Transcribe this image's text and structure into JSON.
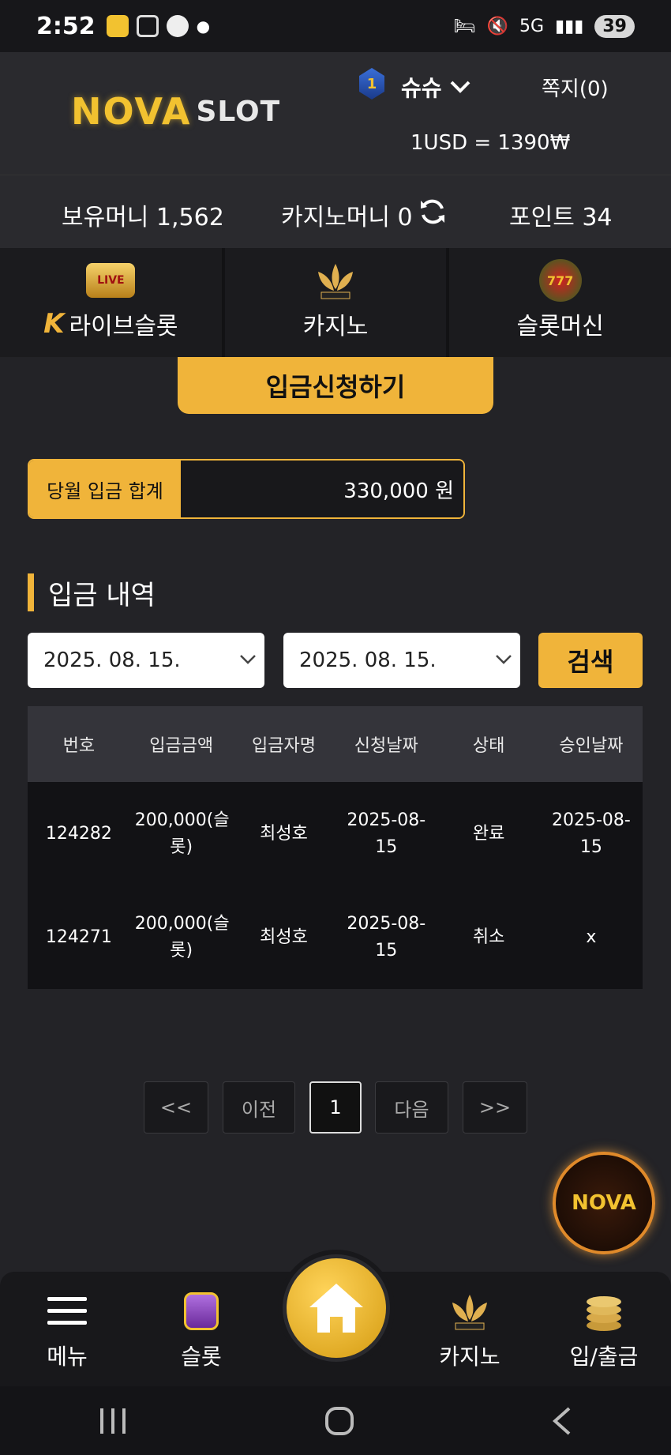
{
  "status_bar": {
    "time": "2:52",
    "network": "5G",
    "battery": "39"
  },
  "header": {
    "logo_left": "NOVA",
    "logo_right": "SLOT",
    "rank": "1",
    "username": "슈슈",
    "messages": "쪽지(0)",
    "exchange_rate": "1USD = 1390₩"
  },
  "balances": {
    "cash": "보유머니 1,562",
    "casino": "카지노머니 0",
    "points": "포인트 34"
  },
  "categories": [
    {
      "label": "라이브슬롯",
      "icon": "live-slot-icon"
    },
    {
      "label": "카지노",
      "icon": "k-slot-lotus-icon"
    },
    {
      "label": "슬롯머신",
      "icon": "777-slots-icon"
    }
  ],
  "deposit_button": "입금신청하기",
  "monthly_total": {
    "label": "당월 입금 합계",
    "value": "330,000 원"
  },
  "history": {
    "title": "입금 내역",
    "date_from": "2025. 08. 15.",
    "date_to": "2025. 08. 15.",
    "search_label": "검색",
    "columns": [
      "번호",
      "입금금액",
      "입금자명",
      "신청날짜",
      "상태",
      "승인날짜"
    ],
    "rows": [
      [
        "124282",
        "200,000(슬롯)",
        "최성호",
        "2025-08-15",
        "완료",
        "2025-08-15"
      ],
      [
        "124271",
        "200,000(슬롯)",
        "최성호",
        "2025-08-15",
        "취소",
        "x"
      ]
    ]
  },
  "pagination": {
    "first": "<<",
    "prev": "이전",
    "current": "1",
    "next": "다음",
    "last": ">>"
  },
  "fab_label": "NOVA",
  "bottom_nav": [
    {
      "label": "메뉴",
      "icon": "hamburger-icon"
    },
    {
      "label": "슬롯",
      "icon": "slot-machine-icon"
    },
    {
      "label": "",
      "icon": "home-icon"
    },
    {
      "label": "카지노",
      "icon": "k-slot-lotus-icon"
    },
    {
      "label": "입/출금",
      "icon": "coins-icon"
    }
  ],
  "colors": {
    "accent": "#f0b43a",
    "background": "#232327",
    "panel": "#2a2a2e",
    "table_body": "#121215"
  }
}
